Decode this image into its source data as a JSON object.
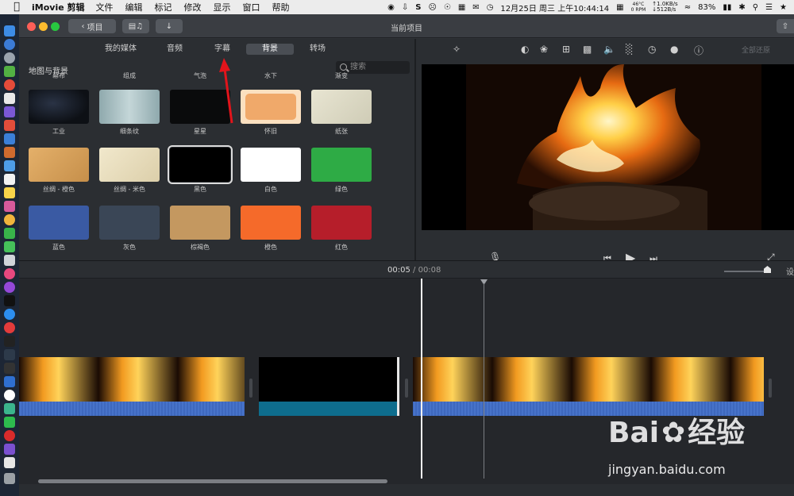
{
  "menubar": {
    "app_name": "iMovie 剪辑",
    "menus": [
      "文件",
      "编辑",
      "标记",
      "修改",
      "显示",
      "窗口",
      "帮助"
    ],
    "temperature": "46°C",
    "fan": "0 RPM",
    "net_up": "↑1.0KB/s",
    "net_down": "↓512B/s",
    "battery": "83%",
    "datetime": "12月25日 周三 上午10:44:14"
  },
  "window": {
    "back_button_label": "项目",
    "title": "当前项目",
    "reset_label": "全部还原"
  },
  "browser": {
    "tabs": [
      {
        "label": "我的媒体",
        "active": false
      },
      {
        "label": "音频",
        "active": false
      },
      {
        "label": "字幕",
        "active": false
      },
      {
        "label": "背景",
        "active": true
      },
      {
        "label": "转场",
        "active": false
      }
    ],
    "panel_title": "地图与背景",
    "search_placeholder": "搜索",
    "top_captions": [
      "幕布",
      "组成",
      "气泡",
      "水下",
      "渐变"
    ],
    "row1": [
      {
        "label": "工业",
        "color": "#0f1217"
      },
      {
        "label": "细条纹",
        "color": "#a9c1c4"
      },
      {
        "label": "星星",
        "color": "#0a0b0c"
      },
      {
        "label": "怀旧",
        "color": "#f0b67c"
      },
      {
        "label": "纸张",
        "color": "#dcd9c4"
      }
    ],
    "row2": [
      {
        "label": "丝绸 - 橙色",
        "color": "#d6a25b"
      },
      {
        "label": "丝绸 - 米色",
        "color": "#e7dcb9"
      },
      {
        "label": "黑色",
        "color": "#000000",
        "selected": true
      },
      {
        "label": "白色",
        "color": "#ffffff"
      },
      {
        "label": "绿色",
        "color": "#2eab45"
      }
    ],
    "row3": [
      {
        "label": "蓝色",
        "color": "#3a5aa3"
      },
      {
        "label": "灰色",
        "color": "#3a4656"
      },
      {
        "label": "棕褐色",
        "color": "#c49860"
      },
      {
        "label": "橙色",
        "color": "#f56a2a"
      },
      {
        "label": "红色",
        "color": "#b61e2a"
      }
    ]
  },
  "timeline": {
    "current_time": "00:05",
    "separator": "/",
    "duration": "00:08",
    "settings_label": "设"
  },
  "watermark": {
    "brand": "Bai",
    "brand_cn": "经验",
    "url": "jingyan.baidu.com"
  },
  "colors": {
    "accent_blue": "#2f6fd0",
    "audio_blue": "#3a63b8",
    "teal": "#0e6d8d",
    "annotation_red": "#e2141b"
  }
}
